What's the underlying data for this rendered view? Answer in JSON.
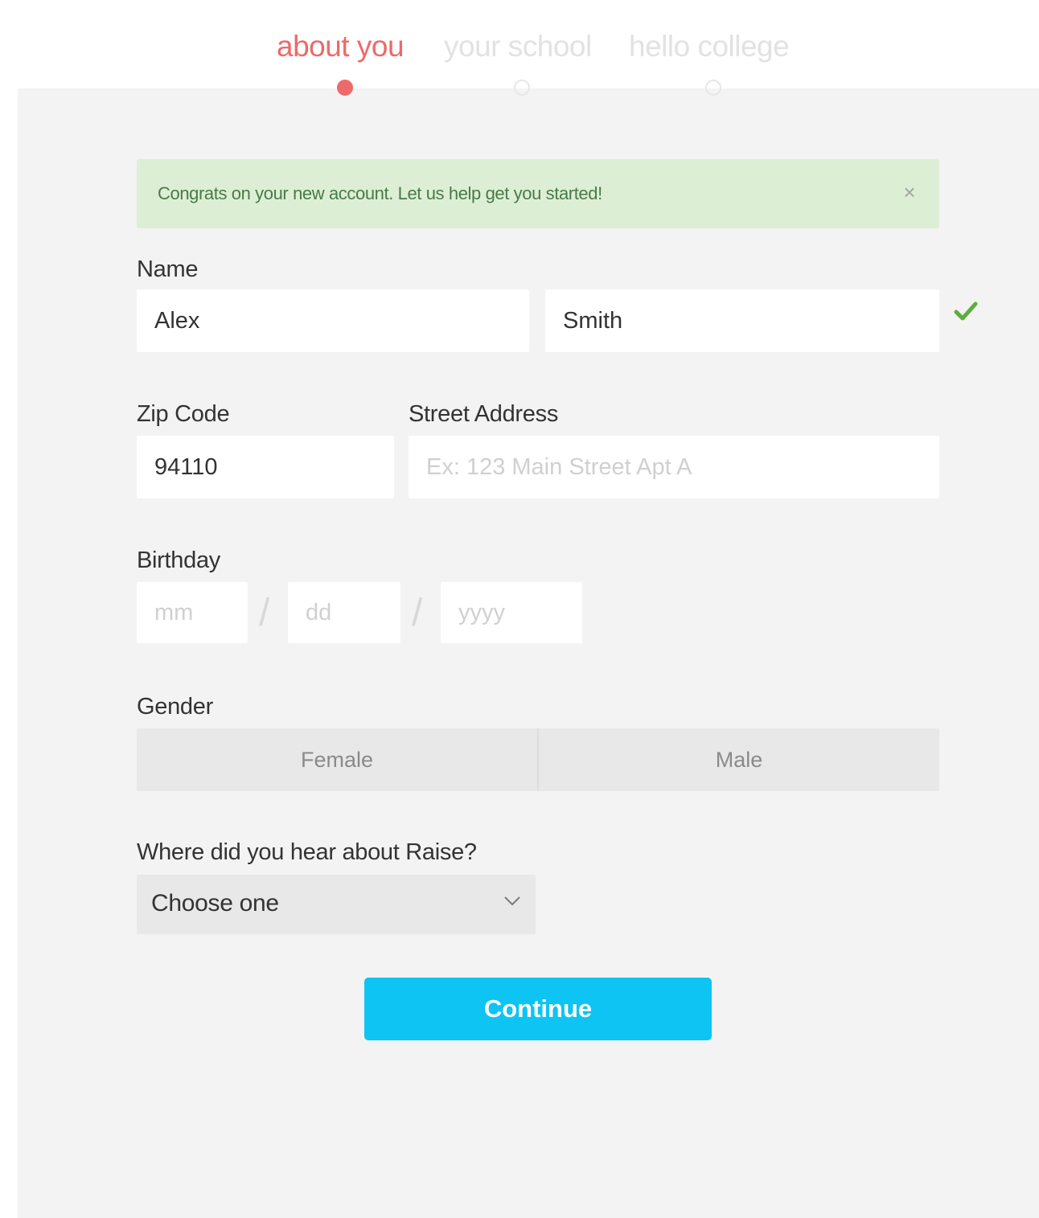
{
  "steps": [
    {
      "label": "about you",
      "state": "active",
      "color": "#ec6a6a"
    },
    {
      "label": "your school",
      "state": "inactive",
      "color": "#e2e2e2"
    },
    {
      "label": "hello college",
      "state": "inactive",
      "color": "#e2e2e2"
    }
  ],
  "alert": {
    "message": "Congrats on your new account. Let us help get you started!",
    "close_icon": "close-icon",
    "close_glyph": "×"
  },
  "form": {
    "name": {
      "label": "Name",
      "first_value": "Alex",
      "last_value": "Smith",
      "valid_icon": "checkmark-icon"
    },
    "zip": {
      "label": "Zip Code",
      "value": "94110"
    },
    "street": {
      "label": "Street Address",
      "value": "",
      "placeholder": "Ex: 123 Main Street Apt A"
    },
    "birthday": {
      "label": "Birthday",
      "month_placeholder": "mm",
      "day_placeholder": "dd",
      "year_placeholder": "yyyy",
      "separator": "/"
    },
    "gender": {
      "label": "Gender",
      "options": [
        "Female",
        "Male"
      ]
    },
    "referral": {
      "label": "Where did you hear about Raise?",
      "selected": "Choose one",
      "icon": "chevron-down-icon"
    },
    "submit_label": "Continue"
  },
  "colors": {
    "accent": "#0dc4f2",
    "active_step": "#ec6a6a",
    "success_bg": "#dcefd5",
    "success_text": "#4b7a46",
    "check": "#5cae3c"
  }
}
